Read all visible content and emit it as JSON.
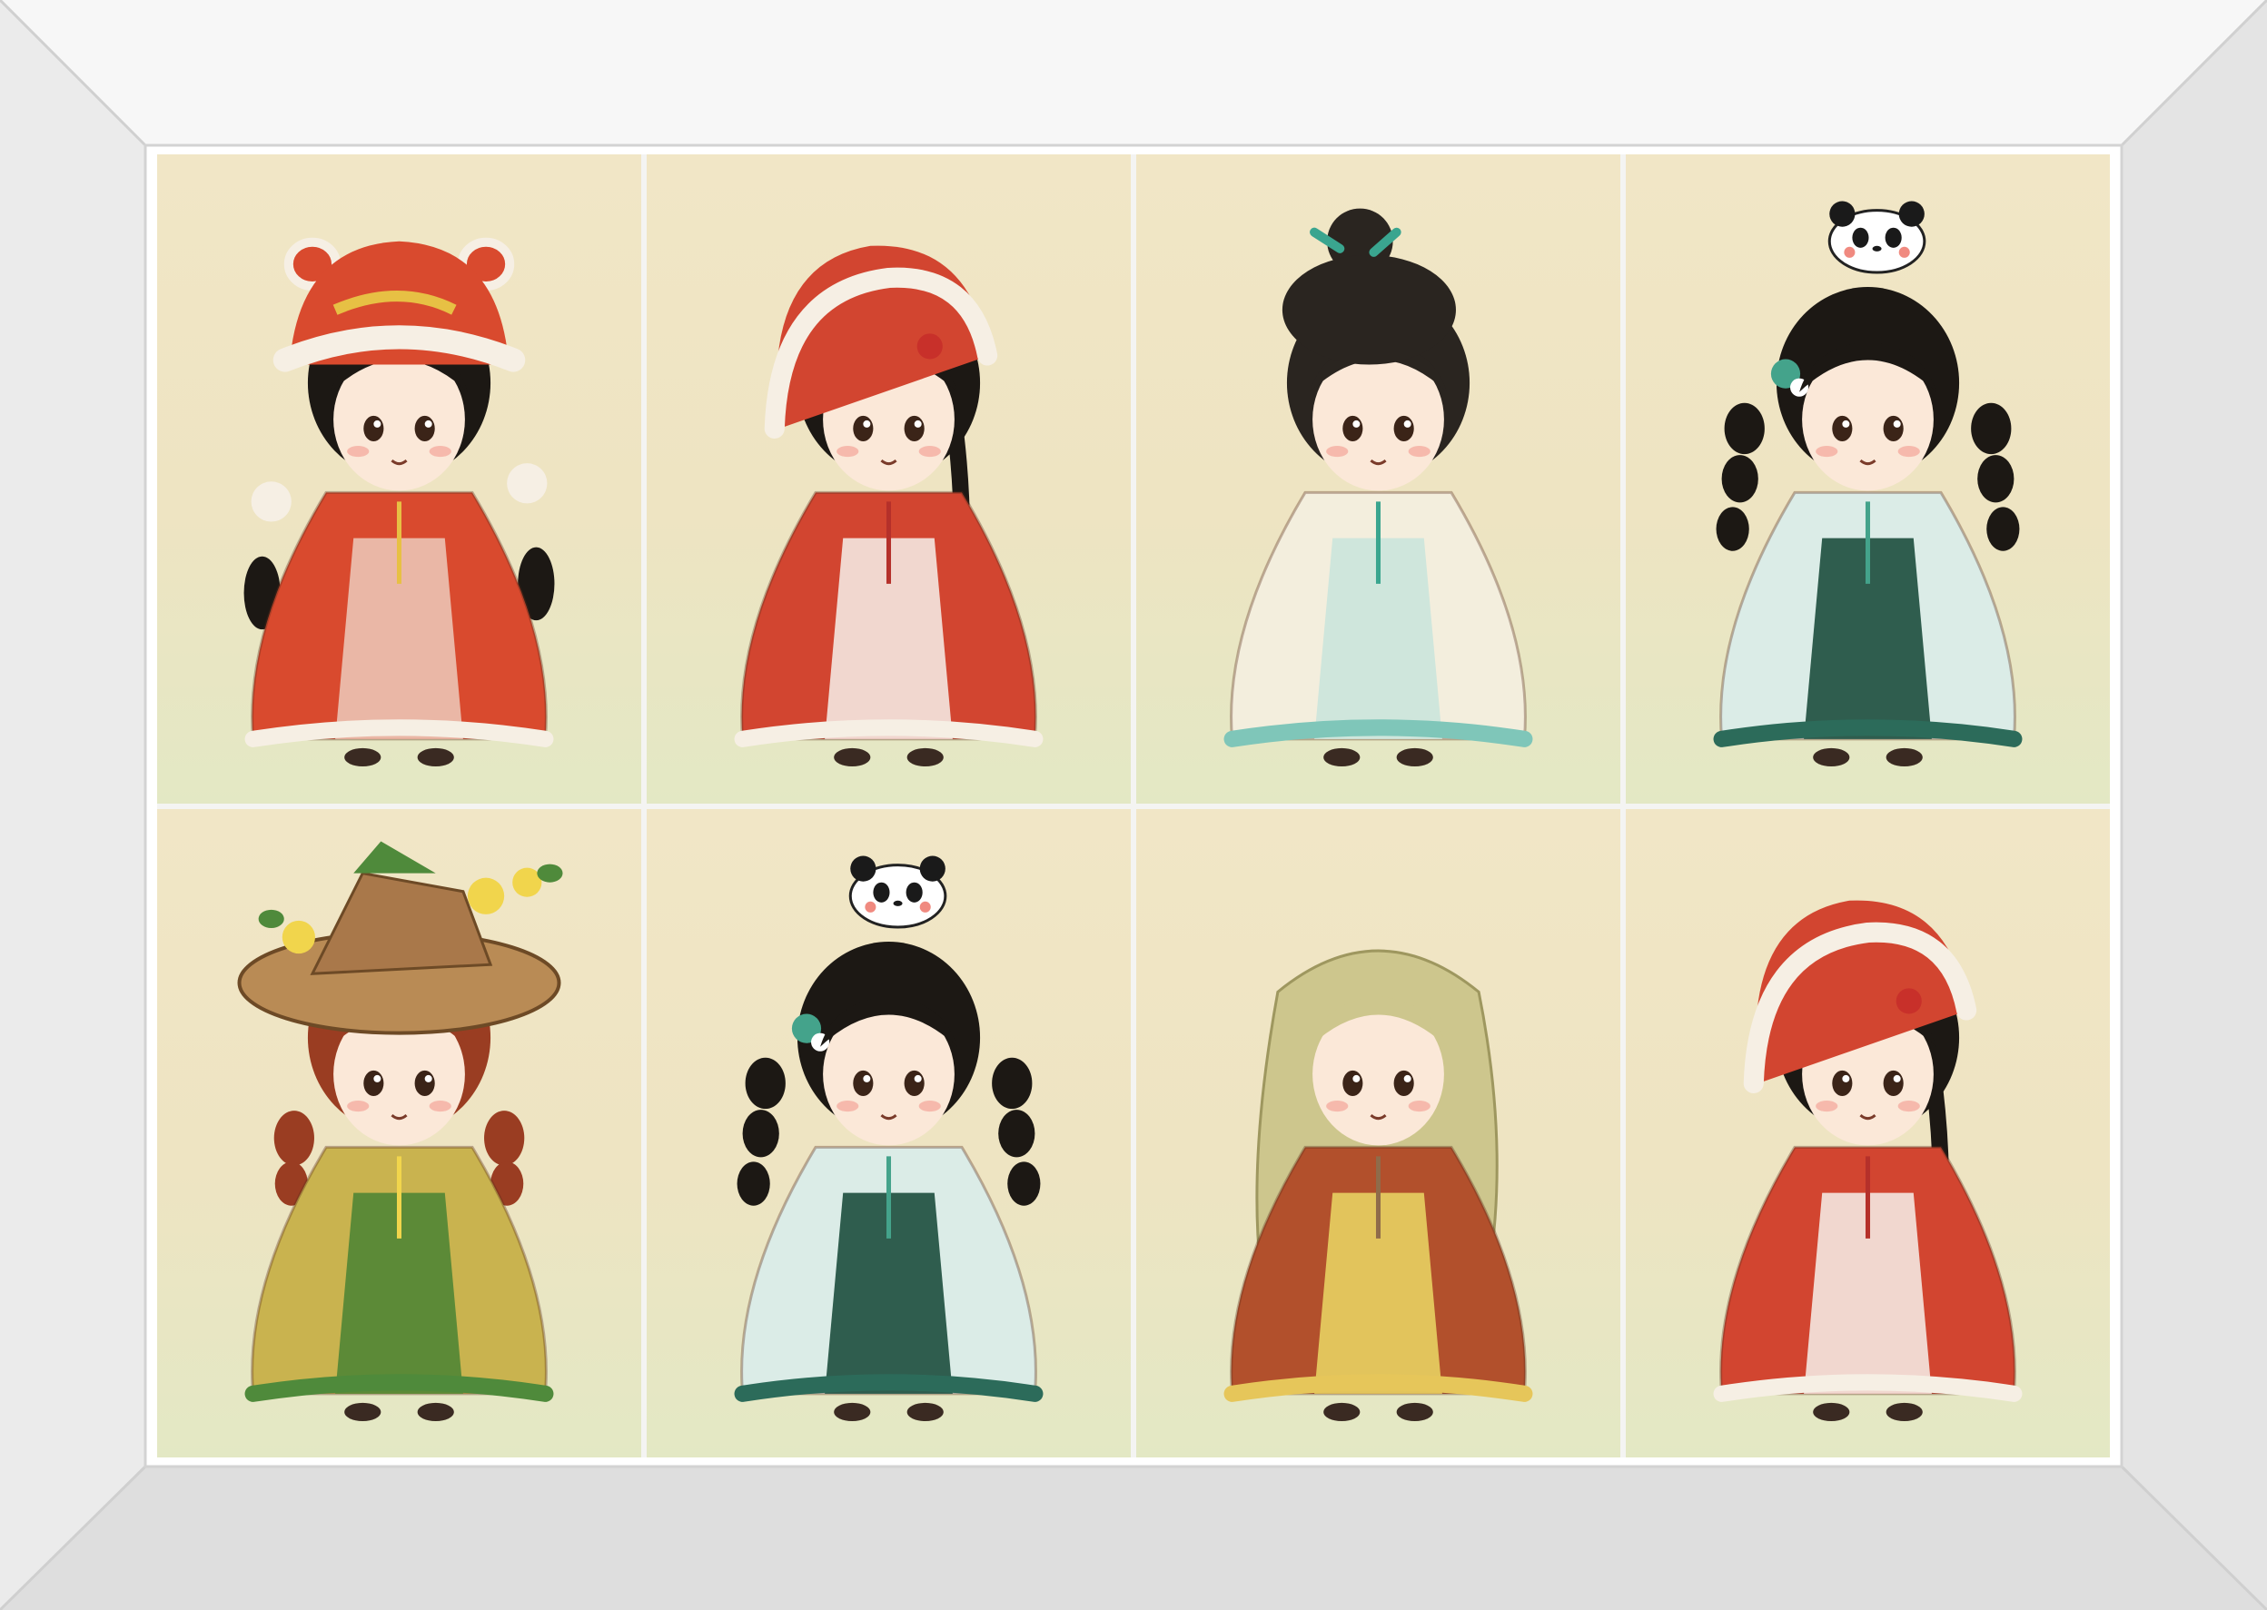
{
  "frame": {
    "color": "#ececec",
    "inner_shadow": "#d6d6d6"
  },
  "panels": [
    {
      "id": "red-bunny-hood-girl",
      "outfit": "#d94a2e",
      "trim": "#f6efe4",
      "hair": "#1c1814",
      "accent": "#e7c044",
      "skirt": "#eab7a6",
      "hat": "bunny-ear-hood",
      "companion": ""
    },
    {
      "id": "red-fur-cloak-girl",
      "outfit": "#d24530",
      "trim": "#f6efe4",
      "hair": "#1c1814",
      "accent": "#b5302a",
      "skirt": "#f1d7cf",
      "hat": "fur-hood",
      "companion": ""
    },
    {
      "id": "white-robe-topknot",
      "outfit": "#f3eedd",
      "trim": "#7fc6b9",
      "hair": "#2a2520",
      "accent": "#3aa58f",
      "skirt": "#cfe6dc",
      "hat": "topknot",
      "companion": ""
    },
    {
      "id": "panda-braids-girl",
      "outfit": "#dbece7",
      "trim": "#2c6b5a",
      "hair": "#1c1814",
      "accent": "#44a38b",
      "skirt": "#2f5d4e",
      "hat": "double-braids",
      "companion": "panda"
    },
    {
      "id": "straw-hat-flower-girl",
      "outfit": "#c9b34f",
      "trim": "#4f8a3b",
      "hair": "#9a3d22",
      "accent": "#f1d54c",
      "skirt": "#5c8a37",
      "hat": "straw-hat",
      "companion": ""
    },
    {
      "id": "panda-braids-girl-2",
      "outfit": "#dbece7",
      "trim": "#2c6b5a",
      "hair": "#1c1814",
      "accent": "#44a38b",
      "skirt": "#2f5d4e",
      "hat": "double-braids",
      "companion": "panda"
    },
    {
      "id": "long-blond-hair-robe",
      "outfit": "#b2502c",
      "trim": "#e6c65a",
      "hair": "#cdc68d",
      "accent": "#8f6b4a",
      "skirt": "#e2c45c",
      "hat": "long-hair",
      "companion": ""
    },
    {
      "id": "red-fur-cloak-girl-2",
      "outfit": "#d24530",
      "trim": "#f6efe4",
      "hair": "#1c1814",
      "accent": "#b5302a",
      "skirt": "#f1d7cf",
      "hat": "fur-hood",
      "companion": ""
    }
  ]
}
